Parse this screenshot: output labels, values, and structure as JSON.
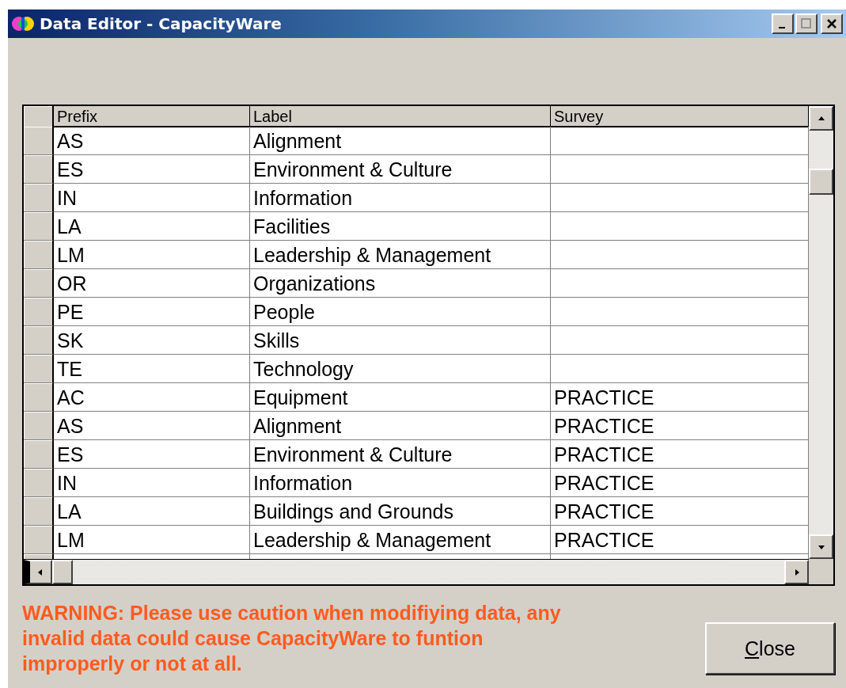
{
  "window": {
    "title": "Data Editor - CapacityWare"
  },
  "table": {
    "columns": [
      "Prefix",
      "Label",
      "Survey"
    ],
    "rows": [
      {
        "prefix": "AS",
        "label": "Alignment",
        "survey": ""
      },
      {
        "prefix": "ES",
        "label": "Environment & Culture",
        "survey": ""
      },
      {
        "prefix": "IN",
        "label": "Information",
        "survey": ""
      },
      {
        "prefix": "LA",
        "label": "Facilities",
        "survey": ""
      },
      {
        "prefix": "LM",
        "label": "Leadership & Management",
        "survey": ""
      },
      {
        "prefix": "OR",
        "label": "Organizations",
        "survey": ""
      },
      {
        "prefix": "PE",
        "label": "People",
        "survey": ""
      },
      {
        "prefix": "SK",
        "label": "Skills",
        "survey": ""
      },
      {
        "prefix": "TE",
        "label": "Technology",
        "survey": ""
      },
      {
        "prefix": "AC",
        "label": "Equipment",
        "survey": "PRACTICE"
      },
      {
        "prefix": "AS",
        "label": "Alignment",
        "survey": "PRACTICE"
      },
      {
        "prefix": "ES",
        "label": "Environment & Culture",
        "survey": "PRACTICE"
      },
      {
        "prefix": "IN",
        "label": "Information",
        "survey": "PRACTICE"
      },
      {
        "prefix": "LA",
        "label": "Buildings and Grounds",
        "survey": "PRACTICE"
      },
      {
        "prefix": "LM",
        "label": "Leadership & Management",
        "survey": "PRACTICE"
      }
    ]
  },
  "warning": "WARNING:  Please use caution when modifiying data, any invalid data could cause CapacityWare to funtion improperly or not at all.",
  "close_button": {
    "label": "Close"
  }
}
